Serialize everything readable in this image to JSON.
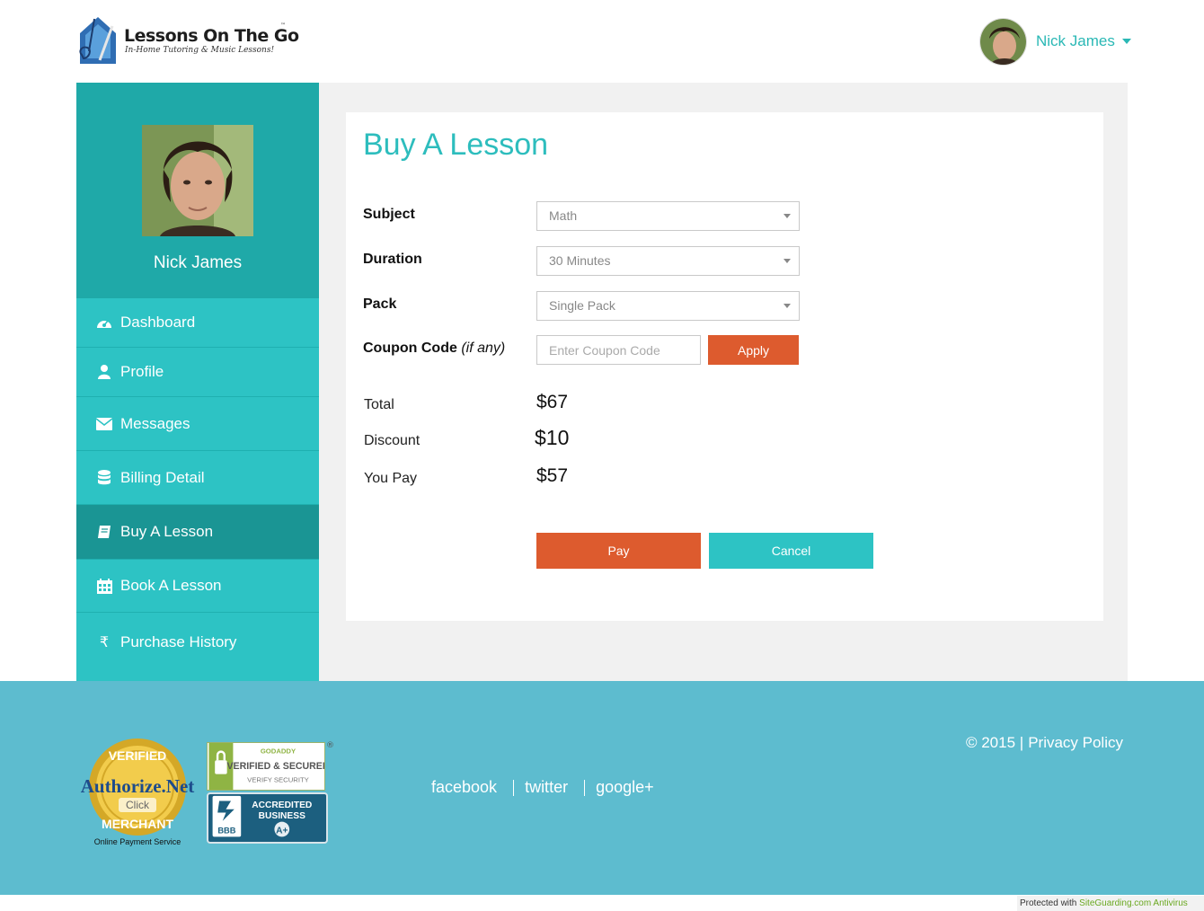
{
  "header": {
    "logo_title": "Lessons On The Go",
    "logo_tm": "™",
    "logo_tagline": "In-Home Tutoring & Music Lessons!",
    "user_name": "Nick James"
  },
  "sidebar": {
    "profile_name": "Nick James",
    "items": [
      {
        "label": "Dashboard",
        "icon": "dashboard-icon"
      },
      {
        "label": "Profile",
        "icon": "user-icon"
      },
      {
        "label": "Messages",
        "icon": "envelope-icon"
      },
      {
        "label": "Billing Detail",
        "icon": "database-icon"
      },
      {
        "label": "Buy A Lesson",
        "icon": "book-icon",
        "active": true
      },
      {
        "label": "Book A Lesson",
        "icon": "calendar-icon"
      },
      {
        "label": "Purchase History",
        "icon": "rupee-icon"
      }
    ]
  },
  "main": {
    "title": "Buy A Lesson",
    "form": {
      "subject_label": "Subject",
      "subject_value": "Math",
      "duration_label": "Duration",
      "duration_value": "30 Minutes",
      "pack_label": "Pack",
      "pack_value": "Single Pack",
      "coupon_label": "Coupon Code",
      "coupon_note": "(if any)",
      "coupon_placeholder": "Enter Coupon Code",
      "apply_label": "Apply"
    },
    "summary": {
      "total_label": "Total",
      "total_value": "$67",
      "discount_label": "Discount",
      "discount_value": "$10",
      "youpay_label": "You Pay",
      "youpay_value": "$57"
    },
    "pay_label": "Pay",
    "cancel_label": "Cancel"
  },
  "footer": {
    "seal_caption": "Online Payment Service",
    "seal_top": "VERIFIED",
    "seal_brand": "Authorize.Net",
    "seal_click": "Click",
    "seal_bottom": "MERCHANT",
    "godaddy_top": "GODADDY",
    "godaddy_mid": "VERIFIED & SECURED",
    "godaddy_bottom": "VERIFY SECURITY",
    "bbb_line1": "ACCREDITED",
    "bbb_line2": "BUSINESS",
    "bbb_rating": "A+",
    "bbb_logo": "BBB",
    "social": [
      "facebook",
      "twitter",
      "google+"
    ],
    "copyright": "© 2015 |",
    "privacy": "Privacy Policy"
  },
  "badge": {
    "prefix": "Protected with",
    "link": "SiteGuarding.com Antivirus"
  },
  "colors": {
    "accent_teal": "#2dc3c4",
    "sidebar_dark": "#1fa9a8",
    "active_item": "#1a9594",
    "action_orange": "#dd5b2e",
    "footer_blue": "#5dbccf"
  }
}
